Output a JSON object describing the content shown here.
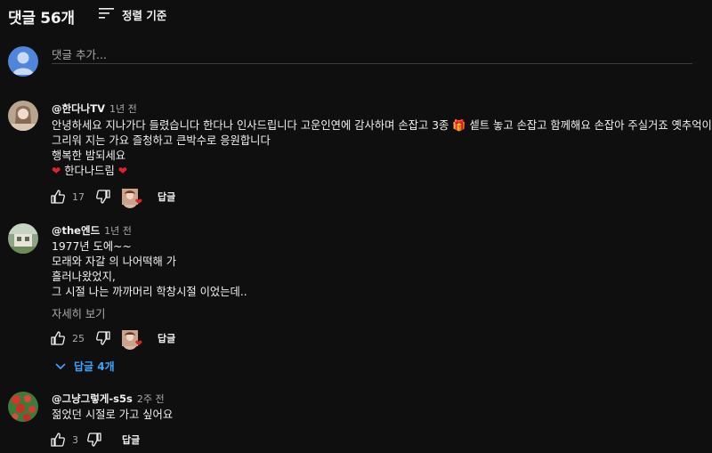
{
  "header": {
    "title": "댓글 56개",
    "sort_label": "정렬 기준"
  },
  "add_comment": {
    "placeholder": "댓글 추가..."
  },
  "comments": [
    {
      "author": "@한다나TV",
      "time": "1년 전",
      "lines": [
        "안녕하세요 지나가다 들렸습니다 한다나 인사드립니다 고운인연에 감사하며 손잡고 3종 🎁 셑트 놓고 손잡고 함께해요  손잡아 주실거죠 옛추억이",
        "그리워 지는 가요 즐청하고 큰박수로 응원합니다",
        "행복한 밤되세요",
        "한다나드림"
      ],
      "likes": "17",
      "reply_label": "답글"
    },
    {
      "author": "@the엔드",
      "time": "1년 전",
      "lines": [
        "1977년 도에~~",
        "모래와 자갈 의 나어떡해 가",
        "흘러나왔었지,",
        "그 시절 나는 까까머리 학창시절 이었는데.."
      ],
      "more_label": "자세히 보기",
      "likes": "25",
      "reply_label": "답글",
      "replies_label": "답글 4개"
    },
    {
      "author": "@그냥그렇게-s5s",
      "time": "2주 전",
      "lines": [
        "젊었던 시절로 가고 싶어요"
      ],
      "likes": "3",
      "reply_label": "답글"
    }
  ],
  "colors": {
    "background": "#0f0f0f",
    "text": "#f1f1f1",
    "secondary": "#aaaaaa",
    "link": "#3ea6ff",
    "heart": "#e0222d"
  },
  "icons": [
    "sort-icon",
    "user-avatar-icon",
    "thumbs-up-icon",
    "thumbs-down-icon",
    "creator-heart-icon",
    "chevron-down-icon",
    "heart-icon"
  ]
}
